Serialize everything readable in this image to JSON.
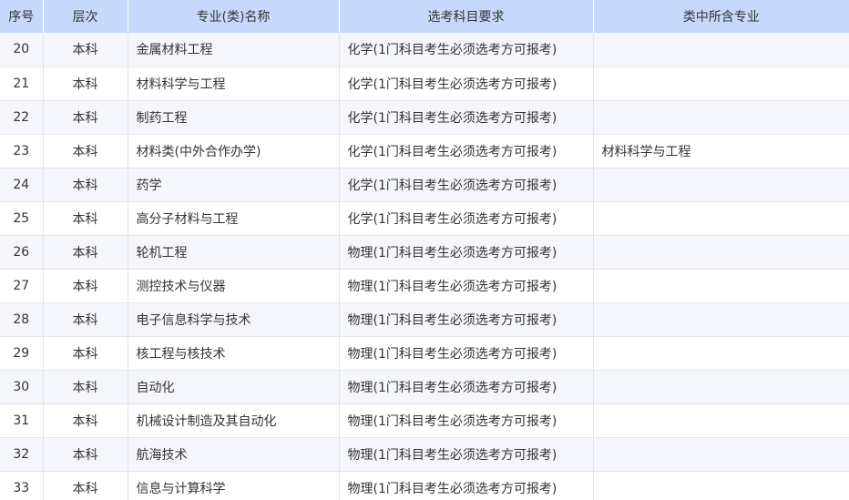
{
  "table": {
    "headers": [
      "序号",
      "层次",
      "专业(类)名称",
      "选考科目要求",
      "类中所含专业"
    ],
    "rows": [
      [
        "20",
        "本科",
        "金属材料工程",
        "化学(1门科目考生必须选考方可报考)",
        ""
      ],
      [
        "21",
        "本科",
        "材料科学与工程",
        "化学(1门科目考生必须选考方可报考)",
        ""
      ],
      [
        "22",
        "本科",
        "制药工程",
        "化学(1门科目考生必须选考方可报考)",
        ""
      ],
      [
        "23",
        "本科",
        "材料类(中外合作办学)",
        "化学(1门科目考生必须选考方可报考)",
        "材料科学与工程"
      ],
      [
        "24",
        "本科",
        "药学",
        "化学(1门科目考生必须选考方可报考)",
        ""
      ],
      [
        "25",
        "本科",
        "高分子材料与工程",
        "化学(1门科目考生必须选考方可报考)",
        ""
      ],
      [
        "26",
        "本科",
        "轮机工程",
        "物理(1门科目考生必须选考方可报考)",
        ""
      ],
      [
        "27",
        "本科",
        "测控技术与仪器",
        "物理(1门科目考生必须选考方可报考)",
        ""
      ],
      [
        "28",
        "本科",
        "电子信息科学与技术",
        "物理(1门科目考生必须选考方可报考)",
        ""
      ],
      [
        "29",
        "本科",
        "核工程与核技术",
        "物理(1门科目考生必须选考方可报考)",
        ""
      ],
      [
        "30",
        "本科",
        "自动化",
        "物理(1门科目考生必须选考方可报考)",
        ""
      ],
      [
        "31",
        "本科",
        "机械设计制造及其自动化",
        "物理(1门科目考生必须选考方可报考)",
        ""
      ],
      [
        "32",
        "本科",
        "航海技术",
        "物理(1门科目考生必须选考方可报考)",
        ""
      ],
      [
        "33",
        "本科",
        "信息与计算科学",
        "物理(1门科目考生必须选考方可报考)",
        ""
      ]
    ]
  },
  "colors": {
    "header_bg": "#c6d9fd",
    "row_alt_bg": "#f4f6fb",
    "grid_line": "#e1e4ea"
  }
}
